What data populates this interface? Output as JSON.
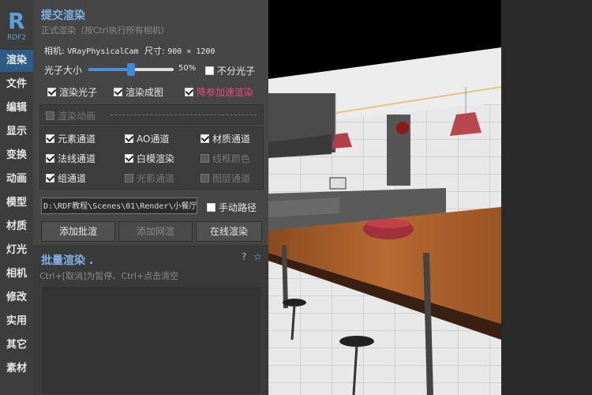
{
  "sidebar": {
    "logo_text": "R",
    "logo_sub": "RDF2",
    "items": [
      "渲染",
      "文件",
      "编辑",
      "显示",
      "变换",
      "动画",
      "模型",
      "材质",
      "灯光",
      "相机",
      "修改",
      "实用",
      "其它",
      "素材"
    ]
  },
  "submit": {
    "title": "提交渲染",
    "subtitle": "正式渲染（按Ctrl执行所有相机）",
    "camera_label": "相机:",
    "camera_value": "VRayPhysicalCam",
    "size_label": "尺寸:",
    "size_value": "900 × 1200",
    "photon_size_label": "光子大小",
    "photon_pct_text": "50%",
    "photon_fraction": 0.5,
    "no_split_photon": "不分光子",
    "render_photon": "渲染光子",
    "render_final": "渲染成图",
    "denoise_render": "降参加速渲染",
    "render_animation": "渲染动画",
    "channels": [
      {
        "label": "元素通道",
        "checked": true,
        "enabled": true
      },
      {
        "label": "AO通道",
        "checked": true,
        "enabled": true
      },
      {
        "label": "材质通道",
        "checked": true,
        "enabled": true
      },
      {
        "label": "法线通道",
        "checked": true,
        "enabled": true
      },
      {
        "label": "白模渲染",
        "checked": true,
        "enabled": true
      },
      {
        "label": "线框颜色",
        "checked": false,
        "enabled": false
      },
      {
        "label": "组通道",
        "checked": true,
        "enabled": true
      },
      {
        "label": "光影通道",
        "checked": false,
        "enabled": false
      },
      {
        "label": "图层通道",
        "checked": false,
        "enabled": false
      }
    ],
    "path_value": "D:\\RDF教程\\Scenes\\01\\Render\\小餐厅",
    "manual_path": "手动路径",
    "btn_add_batch": "添加批渲",
    "btn_add_net": "添加网渲",
    "btn_online": "在线渲染"
  },
  "batch": {
    "title": "批量渲染 .",
    "subtitle": "Ctrl+[取消]为暂停、Ctrl+点击清空",
    "help_icon": "?",
    "star_icon": "☆"
  },
  "colors": {
    "accent": "#2e5c8a",
    "title_blue": "#7fb2e5",
    "pink": "#e8458a"
  }
}
